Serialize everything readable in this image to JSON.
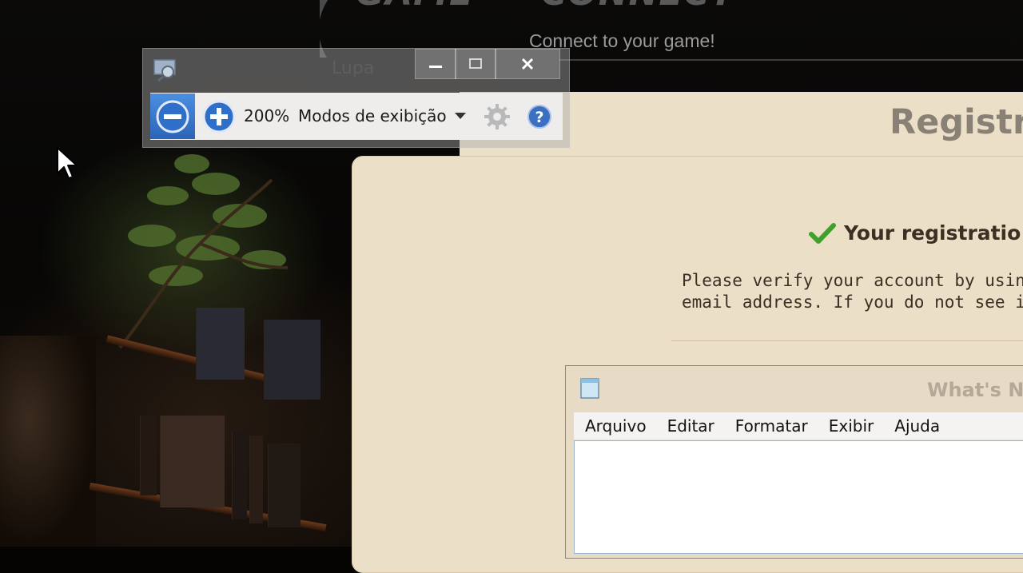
{
  "header": {
    "logo_word_left": "GAME",
    "logo_word_right": "CONNECT",
    "tagline": "Connect to your game!"
  },
  "registration": {
    "title": "Registr",
    "success_message": "Your registratio",
    "verify_line_1": "Please verify your account by using",
    "verify_line_2": "email address. If you do not see it,"
  },
  "notepad": {
    "title": "What's N",
    "menu": [
      "Arquivo",
      "Editar",
      "Formatar",
      "Exibir",
      "Ajuda"
    ],
    "content": ""
  },
  "magnifier": {
    "title": "Lupa",
    "zoom_level": "200%",
    "views_label": "Modos de exibição"
  },
  "colors": {
    "page_bg": "#ecdfc8",
    "check_green": "#3fa02a",
    "magnifier_accent": "#2f6fca"
  }
}
